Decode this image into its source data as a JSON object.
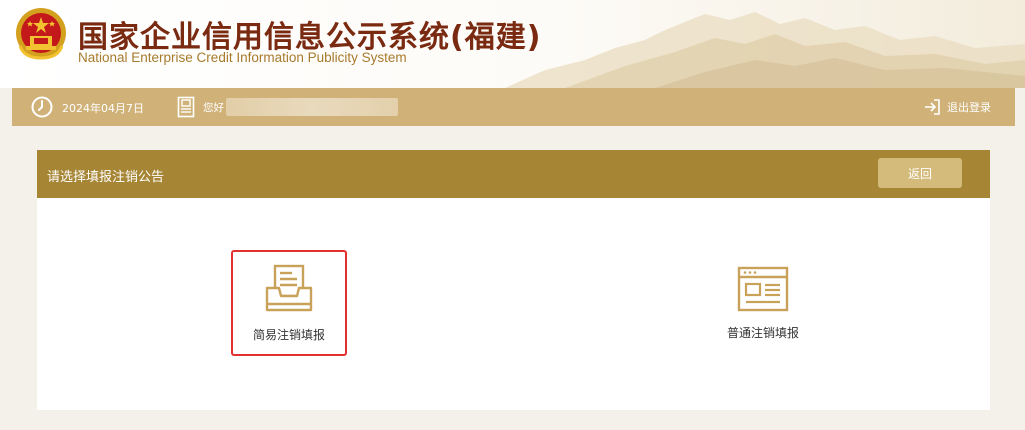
{
  "header": {
    "title": "国家企业信用信息公示系统(福建)",
    "subtitle": "National Enterprise Credit Information Publicity System",
    "emblem_icon": "national-emblem-icon"
  },
  "infobar": {
    "date": "2024年04月7日",
    "greeting": "您好",
    "logout_label": "退出登录",
    "icons": [
      "clock-icon",
      "document-icon",
      "logout-icon"
    ]
  },
  "panel": {
    "title": "请选择填报注销公告",
    "back_label": "返回",
    "options": [
      {
        "label": "简易注销填报",
        "icon": "inbox-tray-icon",
        "selected": true
      },
      {
        "label": "普通注销填报",
        "icon": "web-form-icon",
        "selected": false
      }
    ]
  },
  "colors": {
    "title_red": "#7a2a10",
    "gold_bar": "#d0b279",
    "panel_header": "#a68535",
    "button": "#d4bb7b",
    "icon_gold": "#c8a259",
    "highlight_border": "#e23030"
  }
}
